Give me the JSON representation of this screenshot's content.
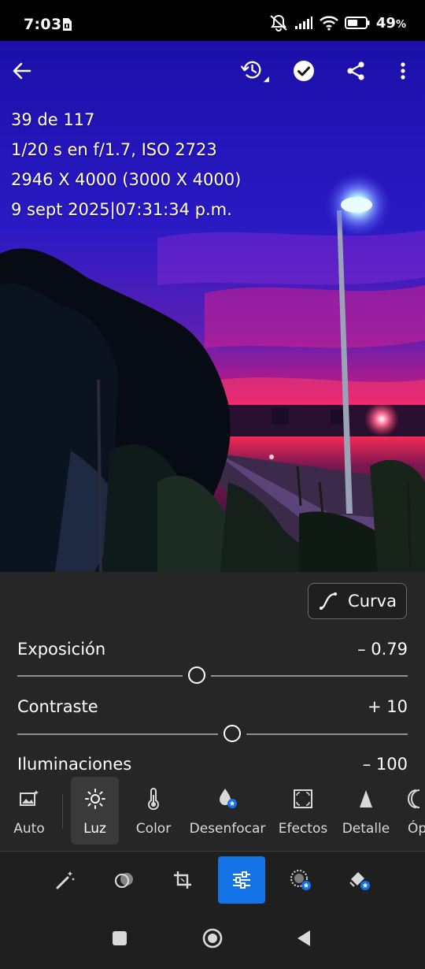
{
  "status_bar": {
    "time": "7:03",
    "battery_percent": "49",
    "battery_unit": "%",
    "icons": [
      "sim-card-icon",
      "mute-icon",
      "signal-icon",
      "wifi-icon",
      "battery-icon"
    ]
  },
  "top_bar": {
    "icons": [
      "back-arrow-icon",
      "history-icon",
      "check-icon",
      "share-icon",
      "more-vertical-icon"
    ]
  },
  "photo_info": {
    "index": "39 de 117",
    "exposure": "1/20 s en f/1.7, ISO 2723",
    "dimensions": "2946 X 4000 (3000 X 4000)",
    "datetime": "9 sept 2025|07:31:34 p.m."
  },
  "panel": {
    "curve_button_label": "Curva",
    "sliders": [
      {
        "label": "Exposición",
        "value": "– 0.79",
        "level": -0.079
      },
      {
        "label": "Contraste",
        "value": "+ 10",
        "level": 0.1
      },
      {
        "label": "Iluminaciones",
        "value": "– 100",
        "level": -1
      }
    ]
  },
  "tools": [
    {
      "label": "Auto",
      "icon": "auto-image-icon",
      "active": false
    },
    {
      "label": "Luz",
      "icon": "sun-icon",
      "active": true
    },
    {
      "label": "Color",
      "icon": "thermometer-icon",
      "active": false
    },
    {
      "label": "Desenfocar",
      "icon": "blur-drop-icon",
      "active": false
    },
    {
      "label": "Efectos",
      "icon": "effects-icon",
      "active": false
    },
    {
      "label": "Detalle",
      "icon": "detail-triangle-icon",
      "active": false
    },
    {
      "label": "Óp",
      "icon": "optics-icon",
      "active": false
    }
  ],
  "modes": [
    {
      "icon": "magic-wand-icon",
      "active": false
    },
    {
      "icon": "presets-icon",
      "active": false
    },
    {
      "icon": "crop-icon",
      "active": false
    },
    {
      "icon": "edit-sliders-icon",
      "active": true
    },
    {
      "icon": "masking-icon",
      "active": false
    },
    {
      "icon": "healing-icon",
      "active": false
    }
  ],
  "nav_bar": {
    "icons": [
      "recents-square-icon",
      "home-circle-icon",
      "back-triangle-icon"
    ]
  },
  "colors": {
    "accent": "#1473e6",
    "panel_bg": "#262626",
    "premium_badge": "#1473e6"
  }
}
